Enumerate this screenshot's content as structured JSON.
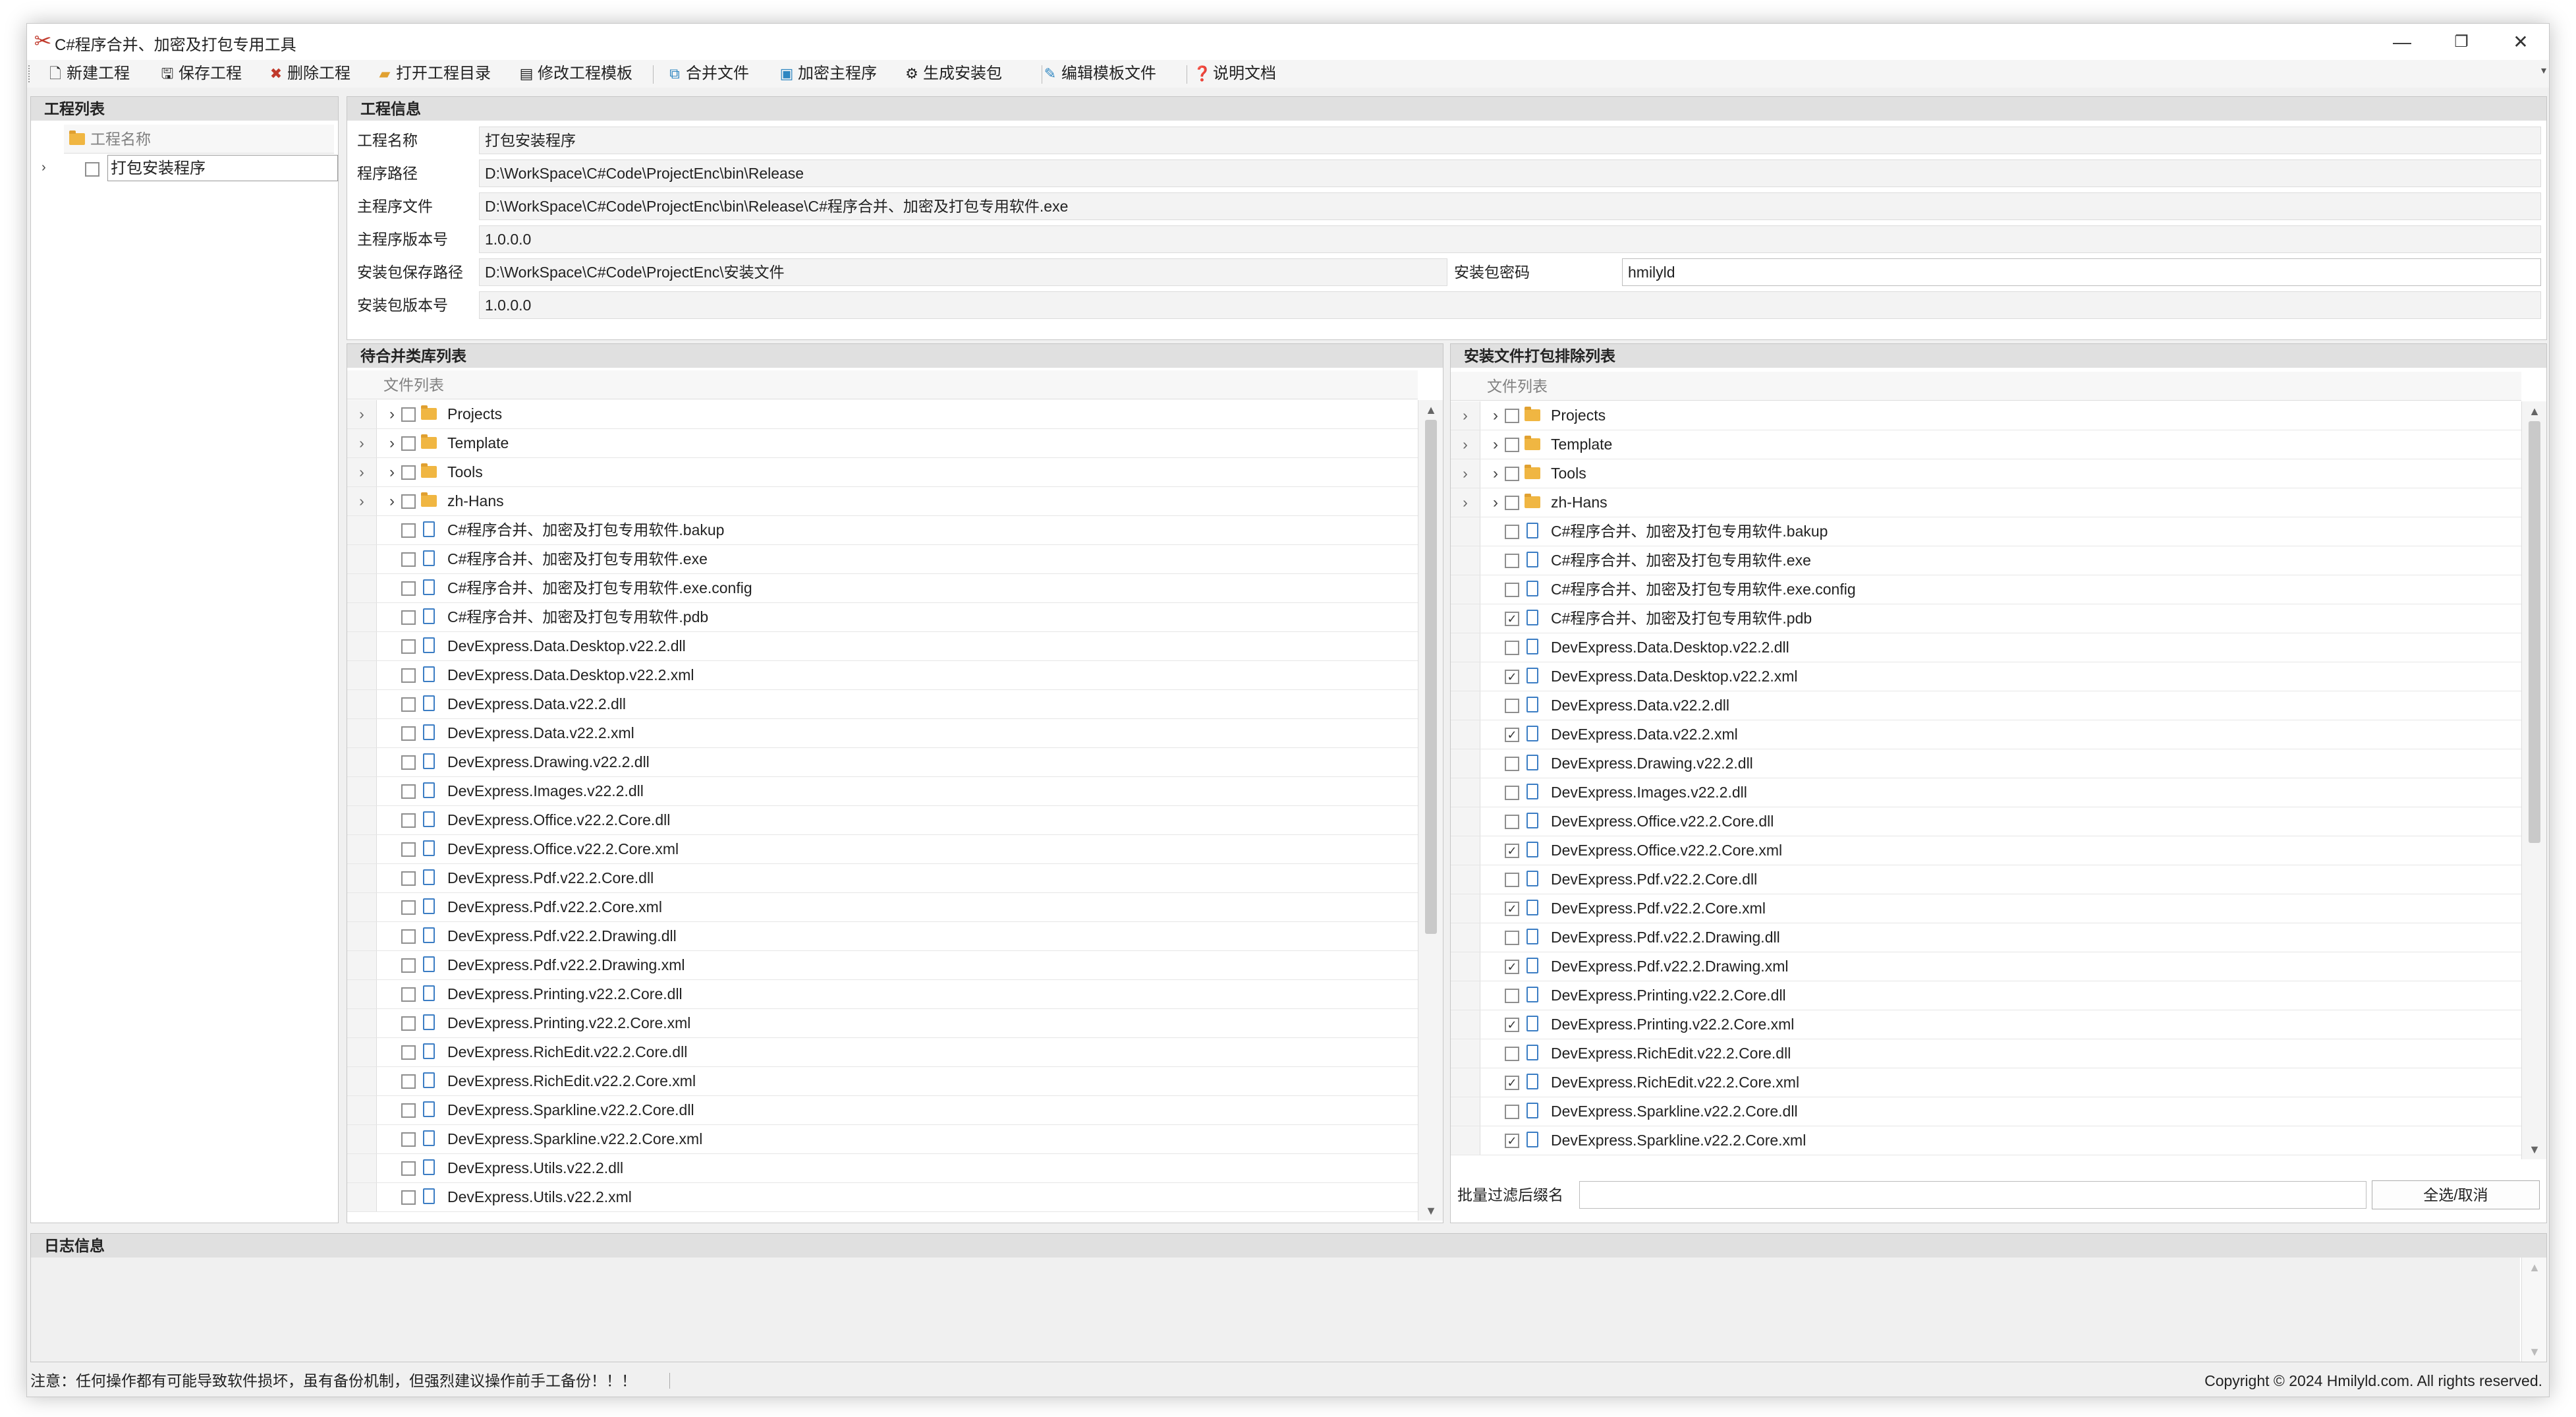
{
  "window": {
    "title": "C#程序合并、加密及打包专用工具"
  },
  "toolbar": {
    "items": [
      {
        "label": "新建工程",
        "icon": "new-file-icon"
      },
      {
        "label": "保存工程",
        "icon": "save-icon"
      },
      {
        "label": "删除工程",
        "icon": "delete-icon"
      },
      {
        "label": "打开工程目录",
        "icon": "folder-open-icon"
      },
      {
        "label": "修改工程模板",
        "icon": "template-icon"
      },
      {
        "label": "合并文件",
        "icon": "merge-icon"
      },
      {
        "label": "加密主程序",
        "icon": "encrypt-icon"
      },
      {
        "label": "生成安装包",
        "icon": "package-icon"
      },
      {
        "label": "编辑模板文件",
        "icon": "edit-icon"
      },
      {
        "label": "说明文档",
        "icon": "help-icon"
      }
    ]
  },
  "project_list": {
    "header": "工程列表",
    "column": "工程名称",
    "items": [
      "打包安装程序"
    ]
  },
  "project_info": {
    "header": "工程信息",
    "fields": [
      {
        "label": "工程名称",
        "value": "打包安装程序"
      },
      {
        "label": "程序路径",
        "value": "D:\\WorkSpace\\C#Code\\ProjectEnc\\bin\\Release"
      },
      {
        "label": "主程序文件",
        "value": "D:\\WorkSpace\\C#Code\\ProjectEnc\\bin\\Release\\C#程序合并、加密及打包专用软件.exe"
      },
      {
        "label": "主程序版本号",
        "value": "1.0.0.0"
      },
      {
        "label": "安装包保存路径",
        "value": "D:\\WorkSpace\\C#Code\\ProjectEnc\\安装文件"
      },
      {
        "label": "安装包版本号",
        "value": "1.0.0.0"
      }
    ],
    "password_label": "安装包密码",
    "password_value": "hmilyld"
  },
  "merge_list": {
    "header": "待合并类库列表",
    "column": "文件列表",
    "rows": [
      {
        "name": "Projects",
        "type": "folder",
        "checked": false
      },
      {
        "name": "Template",
        "type": "folder",
        "checked": false
      },
      {
        "name": "Tools",
        "type": "folder",
        "checked": false
      },
      {
        "name": "zh-Hans",
        "type": "folder",
        "checked": false
      },
      {
        "name": "C#程序合并、加密及打包专用软件.bakup",
        "type": "file",
        "checked": false
      },
      {
        "name": "C#程序合并、加密及打包专用软件.exe",
        "type": "file",
        "checked": false
      },
      {
        "name": "C#程序合并、加密及打包专用软件.exe.config",
        "type": "file",
        "checked": false
      },
      {
        "name": "C#程序合并、加密及打包专用软件.pdb",
        "type": "file",
        "checked": false
      },
      {
        "name": "DevExpress.Data.Desktop.v22.2.dll",
        "type": "file",
        "checked": false
      },
      {
        "name": "DevExpress.Data.Desktop.v22.2.xml",
        "type": "file",
        "checked": false
      },
      {
        "name": "DevExpress.Data.v22.2.dll",
        "type": "file",
        "checked": false
      },
      {
        "name": "DevExpress.Data.v22.2.xml",
        "type": "file",
        "checked": false
      },
      {
        "name": "DevExpress.Drawing.v22.2.dll",
        "type": "file",
        "checked": false
      },
      {
        "name": "DevExpress.Images.v22.2.dll",
        "type": "file",
        "checked": false
      },
      {
        "name": "DevExpress.Office.v22.2.Core.dll",
        "type": "file",
        "checked": false
      },
      {
        "name": "DevExpress.Office.v22.2.Core.xml",
        "type": "file",
        "checked": false
      },
      {
        "name": "DevExpress.Pdf.v22.2.Core.dll",
        "type": "file",
        "checked": false
      },
      {
        "name": "DevExpress.Pdf.v22.2.Core.xml",
        "type": "file",
        "checked": false
      },
      {
        "name": "DevExpress.Pdf.v22.2.Drawing.dll",
        "type": "file",
        "checked": false
      },
      {
        "name": "DevExpress.Pdf.v22.2.Drawing.xml",
        "type": "file",
        "checked": false
      },
      {
        "name": "DevExpress.Printing.v22.2.Core.dll",
        "type": "file",
        "checked": false
      },
      {
        "name": "DevExpress.Printing.v22.2.Core.xml",
        "type": "file",
        "checked": false
      },
      {
        "name": "DevExpress.RichEdit.v22.2.Core.dll",
        "type": "file",
        "checked": false
      },
      {
        "name": "DevExpress.RichEdit.v22.2.Core.xml",
        "type": "file",
        "checked": false
      },
      {
        "name": "DevExpress.Sparkline.v22.2.Core.dll",
        "type": "file",
        "checked": false
      },
      {
        "name": "DevExpress.Sparkline.v22.2.Core.xml",
        "type": "file",
        "checked": false
      },
      {
        "name": "DevExpress.Utils.v22.2.dll",
        "type": "file",
        "checked": false
      },
      {
        "name": "DevExpress.Utils.v22.2.xml",
        "type": "file",
        "checked": false
      }
    ]
  },
  "exclude_list": {
    "header": "安装文件打包排除列表",
    "column": "文件列表",
    "rows": [
      {
        "name": "Projects",
        "type": "folder",
        "checked": false
      },
      {
        "name": "Template",
        "type": "folder",
        "checked": false
      },
      {
        "name": "Tools",
        "type": "folder",
        "checked": false
      },
      {
        "name": "zh-Hans",
        "type": "folder",
        "checked": false
      },
      {
        "name": "C#程序合并、加密及打包专用软件.bakup",
        "type": "file",
        "checked": false
      },
      {
        "name": "C#程序合并、加密及打包专用软件.exe",
        "type": "file",
        "checked": false
      },
      {
        "name": "C#程序合并、加密及打包专用软件.exe.config",
        "type": "file",
        "checked": false
      },
      {
        "name": "C#程序合并、加密及打包专用软件.pdb",
        "type": "file",
        "checked": true
      },
      {
        "name": "DevExpress.Data.Desktop.v22.2.dll",
        "type": "file",
        "checked": false
      },
      {
        "name": "DevExpress.Data.Desktop.v22.2.xml",
        "type": "file",
        "checked": true
      },
      {
        "name": "DevExpress.Data.v22.2.dll",
        "type": "file",
        "checked": false
      },
      {
        "name": "DevExpress.Data.v22.2.xml",
        "type": "file",
        "checked": true
      },
      {
        "name": "DevExpress.Drawing.v22.2.dll",
        "type": "file",
        "checked": false
      },
      {
        "name": "DevExpress.Images.v22.2.dll",
        "type": "file",
        "checked": false
      },
      {
        "name": "DevExpress.Office.v22.2.Core.dll",
        "type": "file",
        "checked": false
      },
      {
        "name": "DevExpress.Office.v22.2.Core.xml",
        "type": "file",
        "checked": true
      },
      {
        "name": "DevExpress.Pdf.v22.2.Core.dll",
        "type": "file",
        "checked": false
      },
      {
        "name": "DevExpress.Pdf.v22.2.Core.xml",
        "type": "file",
        "checked": true
      },
      {
        "name": "DevExpress.Pdf.v22.2.Drawing.dll",
        "type": "file",
        "checked": false
      },
      {
        "name": "DevExpress.Pdf.v22.2.Drawing.xml",
        "type": "file",
        "checked": true
      },
      {
        "name": "DevExpress.Printing.v22.2.Core.dll",
        "type": "file",
        "checked": false
      },
      {
        "name": "DevExpress.Printing.v22.2.Core.xml",
        "type": "file",
        "checked": true
      },
      {
        "name": "DevExpress.RichEdit.v22.2.Core.dll",
        "type": "file",
        "checked": false
      },
      {
        "name": "DevExpress.RichEdit.v22.2.Core.xml",
        "type": "file",
        "checked": true
      },
      {
        "name": "DevExpress.Sparkline.v22.2.Core.dll",
        "type": "file",
        "checked": false
      },
      {
        "name": "DevExpress.Sparkline.v22.2.Core.xml",
        "type": "file",
        "checked": true
      }
    ],
    "filter_label": "批量过滤后缀名",
    "filter_value": "",
    "select_all_label": "全选/取消"
  },
  "log": {
    "header": "日志信息"
  },
  "status": {
    "warning": "注意：任何操作都有可能导致软件损坏，虽有备份机制，但强烈建议操作前手工备份！！！",
    "copyright": "Copyright © 2024 Hmilyld.com. All rights reserved."
  },
  "colors": {
    "panel_header": "#e0e0e0",
    "folder": "#f0b642",
    "file": "#3b7dc4",
    "app_icon": "#c0392b"
  }
}
